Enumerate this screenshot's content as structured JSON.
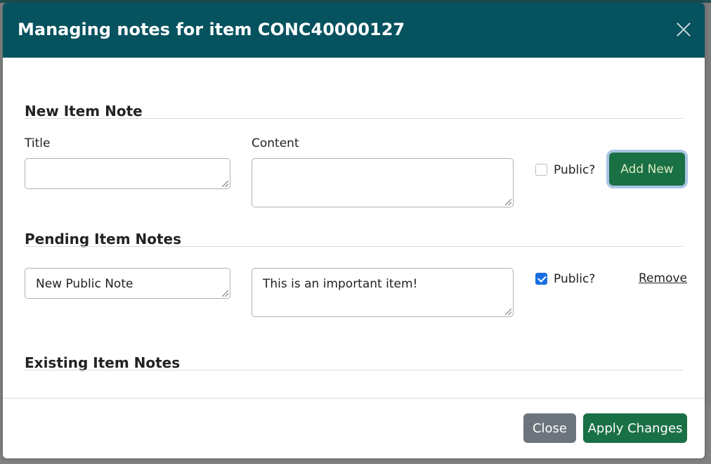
{
  "modal": {
    "title": "Managing notes for item CONC40000127",
    "close_icon": "close-icon"
  },
  "new_note": {
    "section_title": "New Item Note",
    "title_label": "Title",
    "content_label": "Content",
    "title_value": "",
    "content_value": "",
    "public_label": "Public?",
    "public_checked": false,
    "add_button_label": "Add New"
  },
  "pending_notes": {
    "section_title": "Pending Item Notes",
    "items": [
      {
        "title": "New Public Note",
        "content": "This is an important item!",
        "public_label": "Public?",
        "public_checked": true,
        "remove_label": "Remove"
      }
    ]
  },
  "existing_notes": {
    "section_title": "Existing Item Notes"
  },
  "footer": {
    "close_label": "Close",
    "apply_label": "Apply Changes"
  },
  "colors": {
    "header_bg": "#06525f",
    "primary_button": "#1a7045",
    "secondary_button": "#6c757d",
    "checkbox_checked": "#1a6fe0"
  }
}
